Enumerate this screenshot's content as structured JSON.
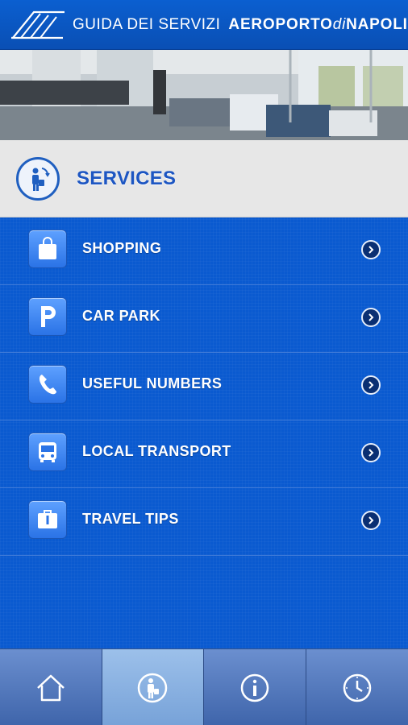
{
  "header": {
    "guide_label": "GUIDA DEI SERVIZI",
    "brand_left": "AEROPORTO",
    "brand_mid": "di",
    "brand_right": "NAPOLI"
  },
  "section": {
    "title": "SERVICES",
    "icon": "traveler-icon"
  },
  "items": [
    {
      "label": "SHOPPING",
      "icon": "shopping-bag-icon"
    },
    {
      "label": "CAR PARK",
      "icon": "parking-icon"
    },
    {
      "label": "USEFUL NUMBERS",
      "icon": "phone-icon"
    },
    {
      "label": "LOCAL TRANSPORT",
      "icon": "bus-icon"
    },
    {
      "label": "TRAVEL TIPS",
      "icon": "first-aid-bag-icon"
    }
  ],
  "tabs": [
    {
      "icon": "home-icon",
      "active": false
    },
    {
      "icon": "traveler-icon",
      "active": true
    },
    {
      "icon": "info-icon",
      "active": false
    },
    {
      "icon": "clock-icon",
      "active": false
    }
  ],
  "colors": {
    "primary_blue": "#0a5ad0",
    "title_blue": "#1d56c2",
    "tabbar": "#4f74b8"
  }
}
